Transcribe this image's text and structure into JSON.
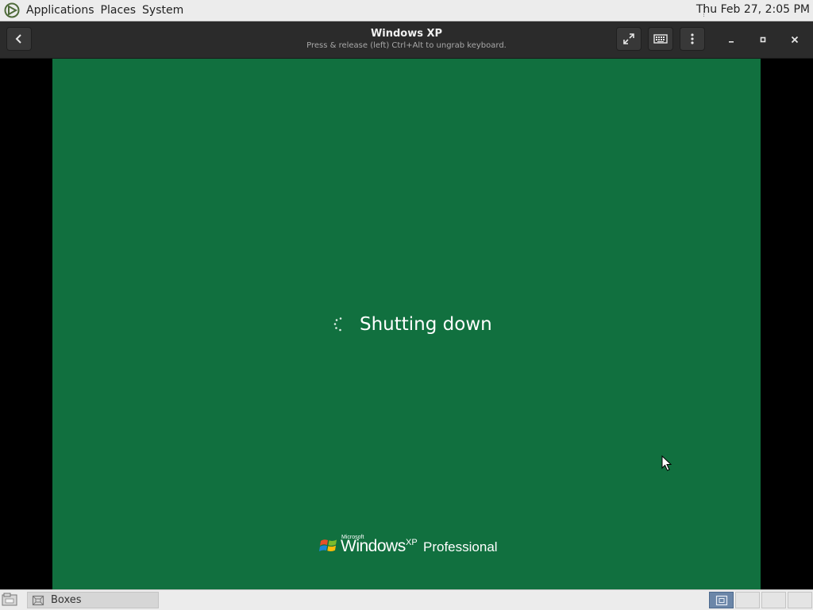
{
  "top_panel": {
    "menus": [
      "Applications",
      "Places",
      "System"
    ],
    "clock": "Thu Feb 27,  2:05 PM",
    "icons": {
      "logo": "distro-logo-icon"
    }
  },
  "header": {
    "title": "Windows XP",
    "subtitle": "Press & release (left) Ctrl+Alt to ungrab keyboard.",
    "buttons": {
      "back": "back-arrow-icon",
      "fullscreen": "fullscreen-icon",
      "keyboard": "keyboard-icon",
      "menu": "kebab-menu-icon",
      "minimize": "minimize-icon",
      "maximize": "maximize-icon",
      "close": "close-icon"
    }
  },
  "vm": {
    "status_text": "Shutting down",
    "background_color": "#11703f",
    "logo": {
      "microsoft": "Microsoft",
      "windows": "Windows",
      "xp": "XP",
      "edition": "Professional"
    }
  },
  "bottom_panel": {
    "taskbar_item": "Boxes",
    "workspaces": 4,
    "active_workspace": 1
  }
}
